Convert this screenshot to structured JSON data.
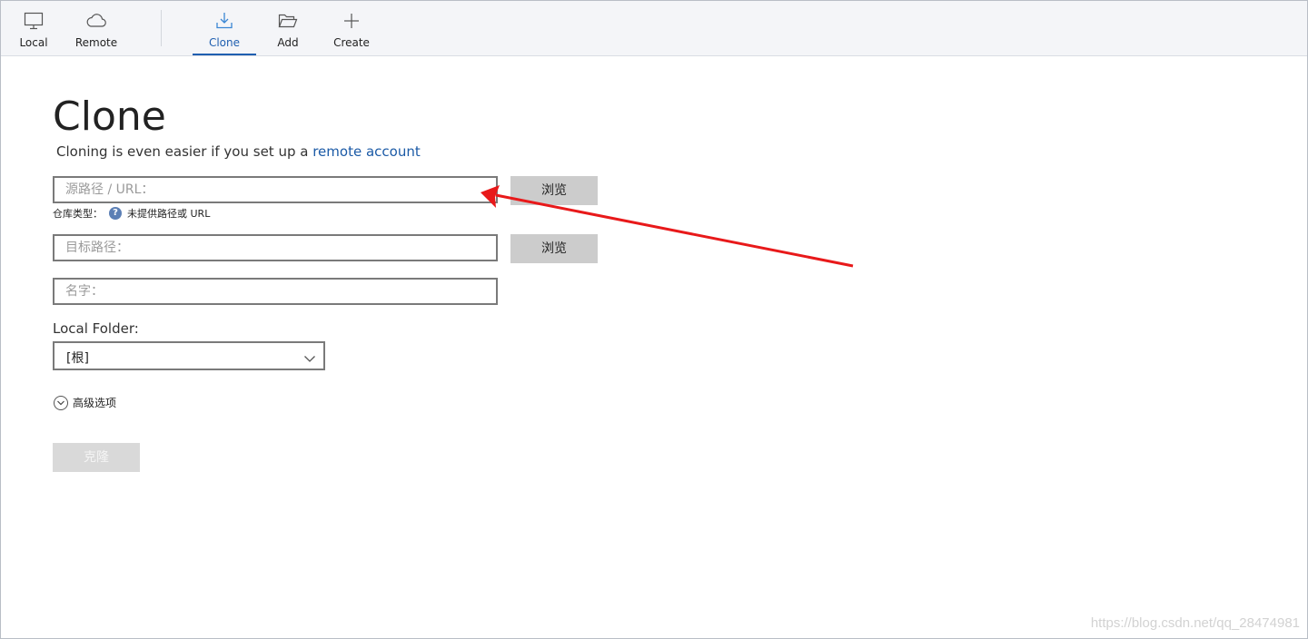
{
  "toolbar": {
    "local_label": "Local",
    "remote_label": "Remote",
    "clone_label": "Clone",
    "add_label": "Add",
    "create_label": "Create",
    "active_tab": "Clone",
    "accent_color": "#1f5fb0"
  },
  "clone_page": {
    "title": "Clone",
    "subtitle_prefix": "Cloning is even easier if you set up a ",
    "subtitle_link": "remote account",
    "source": {
      "placeholder": "源路径 / URL：",
      "value": "",
      "browse_label": "浏览"
    },
    "repo_type": {
      "label": "仓库类型：",
      "icon": "question-icon",
      "value": "未提供路径或 URL"
    },
    "destination": {
      "placeholder": "目标路径：",
      "value": "",
      "browse_label": "浏览"
    },
    "name": {
      "placeholder": "名字：",
      "value": ""
    },
    "local_folder": {
      "label": "Local Folder:",
      "selected": "[根]"
    },
    "advanced": {
      "label": "高级选项"
    },
    "clone_button": "克隆"
  },
  "annotation": {
    "type": "red-arrow",
    "color": "#e8191a",
    "points_to": "source-url-input"
  },
  "watermark": "https://blog.csdn.net/qq_28474981"
}
